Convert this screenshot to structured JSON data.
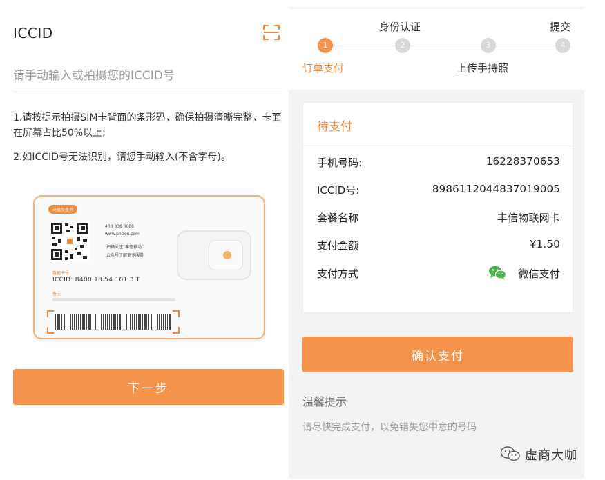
{
  "left": {
    "title": "ICCID",
    "input_placeholder": "请手动输入或拍摄您的ICCID号",
    "tips": [
      "1.请按提示拍摄SIM卡背面的条形码，确保拍摄清晰完整，卡面在屏幕占比50%以上;",
      "2.如ICCID号无法识别，请您手动输入(不含字母)。"
    ],
    "card": {
      "badge": "充值及查询",
      "phone": "400 838 0088",
      "site": "www.phtion.com",
      "scan_text_1": "扫描关注“丰信移动”",
      "scan_text_2": "公众号了解更多服务",
      "label_1": "数据卡号",
      "iccid": "ICCID:  8400     18  54      101  3     T",
      "label_2": "备注"
    },
    "next_button": "下一步"
  },
  "right": {
    "steps": {
      "top_labels": [
        "身份认证",
        "提交"
      ],
      "bottom_labels": [
        "订单支付",
        "上传手持照"
      ],
      "numbers": [
        "1",
        "2",
        "3",
        "4"
      ],
      "current": 1
    },
    "payment": {
      "status": "待支付",
      "rows": [
        {
          "key": "手机号码:",
          "value": "16228370653"
        },
        {
          "key": "ICCID号:",
          "value": "8986112044837019005"
        },
        {
          "key": "套餐名称",
          "value": "丰信物联网卡"
        },
        {
          "key": "支付金额",
          "value": "¥1.50"
        },
        {
          "key": "支付方式",
          "value": "微信支付"
        }
      ]
    },
    "confirm_button": "确认支付",
    "warm_title": "温馨提示",
    "warm_text": "请尽快完成支付，以免错失您中意的号码"
  },
  "watermark": "虚商大咖",
  "colors": {
    "accent": "#f5924b",
    "accent_text": "#f08a3c",
    "wechat_green": "#4bb34b"
  },
  "icons": [
    "scan-icon",
    "wechat-icon",
    "wechat-watermark-icon",
    "qr-code-icon"
  ]
}
